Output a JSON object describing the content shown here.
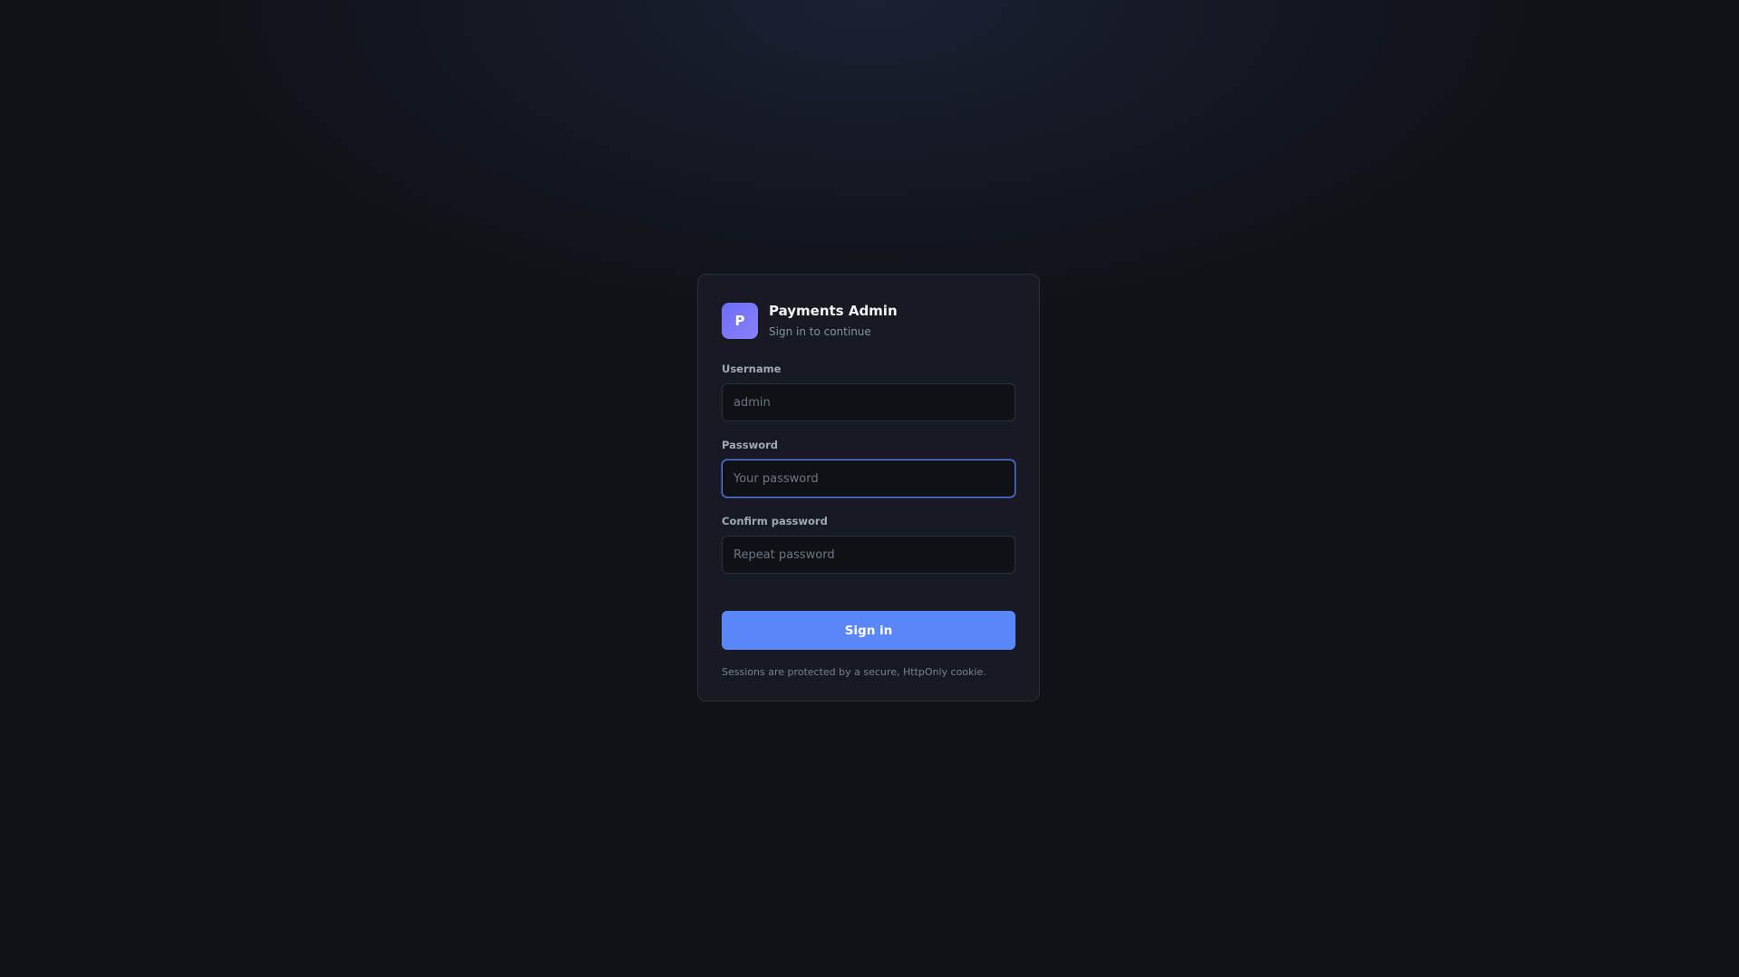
{
  "app": {
    "logo_letter": "P",
    "title": "Payments Admin",
    "subtitle": "Sign in to continue"
  },
  "form": {
    "username": {
      "label": "Username",
      "value": "",
      "placeholder": "admin"
    },
    "password": {
      "label": "Password",
      "value": "",
      "placeholder": "Your password",
      "focused": true
    },
    "confirm_password": {
      "label": "Confirm password",
      "value": "",
      "placeholder": "Repeat password"
    },
    "submit_label": "Sign in"
  },
  "footnote": "Sessions are protected by a secure, HttpOnly cookie.",
  "colors": {
    "accent": "#5a86f7",
    "logo": "#7674f8",
    "background": "#101217",
    "card": "#171a22"
  }
}
